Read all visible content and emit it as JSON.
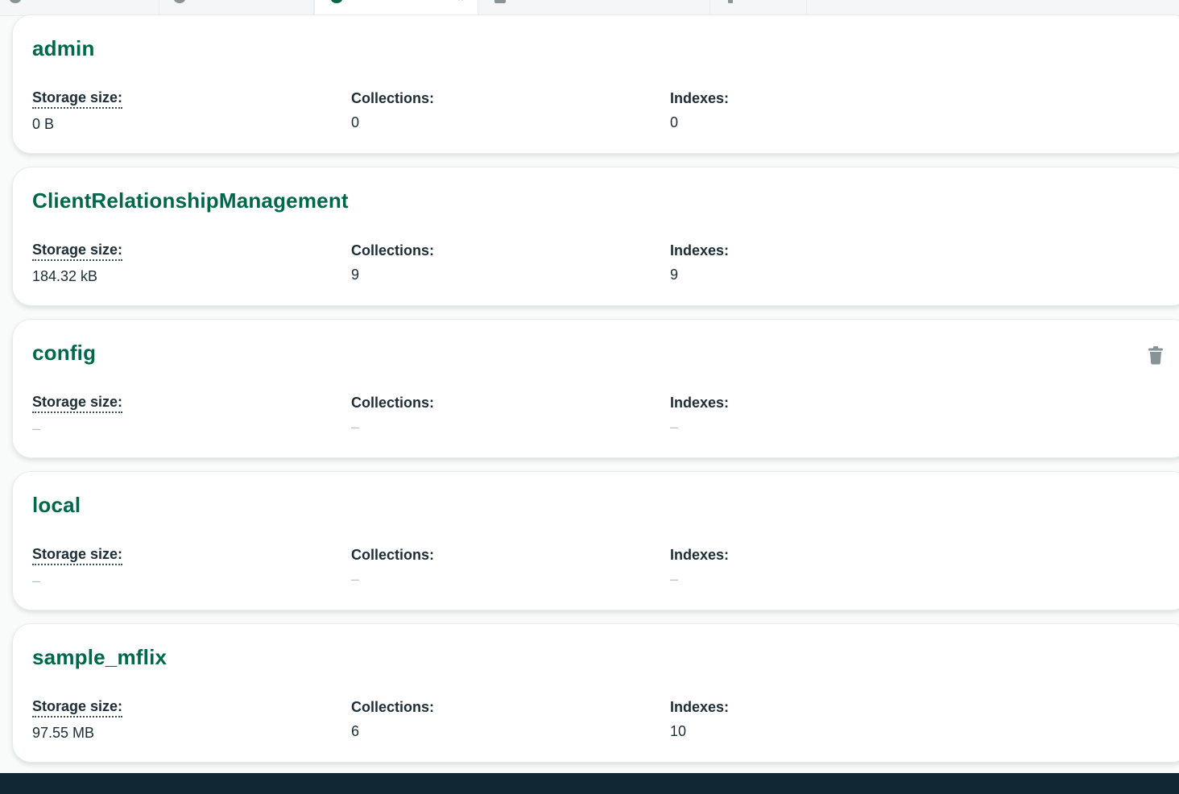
{
  "colors": {
    "title_green": "#00684a",
    "footer_dark": "#112733",
    "label_text": "#1c2d38",
    "empty_value": "#b8c4c2",
    "icon_gray": "#889397"
  },
  "labels": {
    "storage": "Storage size:",
    "collections": "Collections:",
    "indexes": "Indexes:"
  },
  "databases": [
    {
      "name": "admin",
      "storage": "0 B",
      "collections": "0",
      "indexes": "0"
    },
    {
      "name": "ClientRelationshipManagement",
      "storage": "184.32 kB",
      "collections": "9",
      "indexes": "9"
    },
    {
      "name": "config",
      "storage": "–",
      "collections": "–",
      "indexes": "–",
      "hover_action": "trash-icon"
    },
    {
      "name": "local",
      "storage": "–",
      "collections": "–",
      "indexes": "–"
    },
    {
      "name": "sample_mflix",
      "storage": "97.55 MB",
      "collections": "6",
      "indexes": "10"
    }
  ]
}
